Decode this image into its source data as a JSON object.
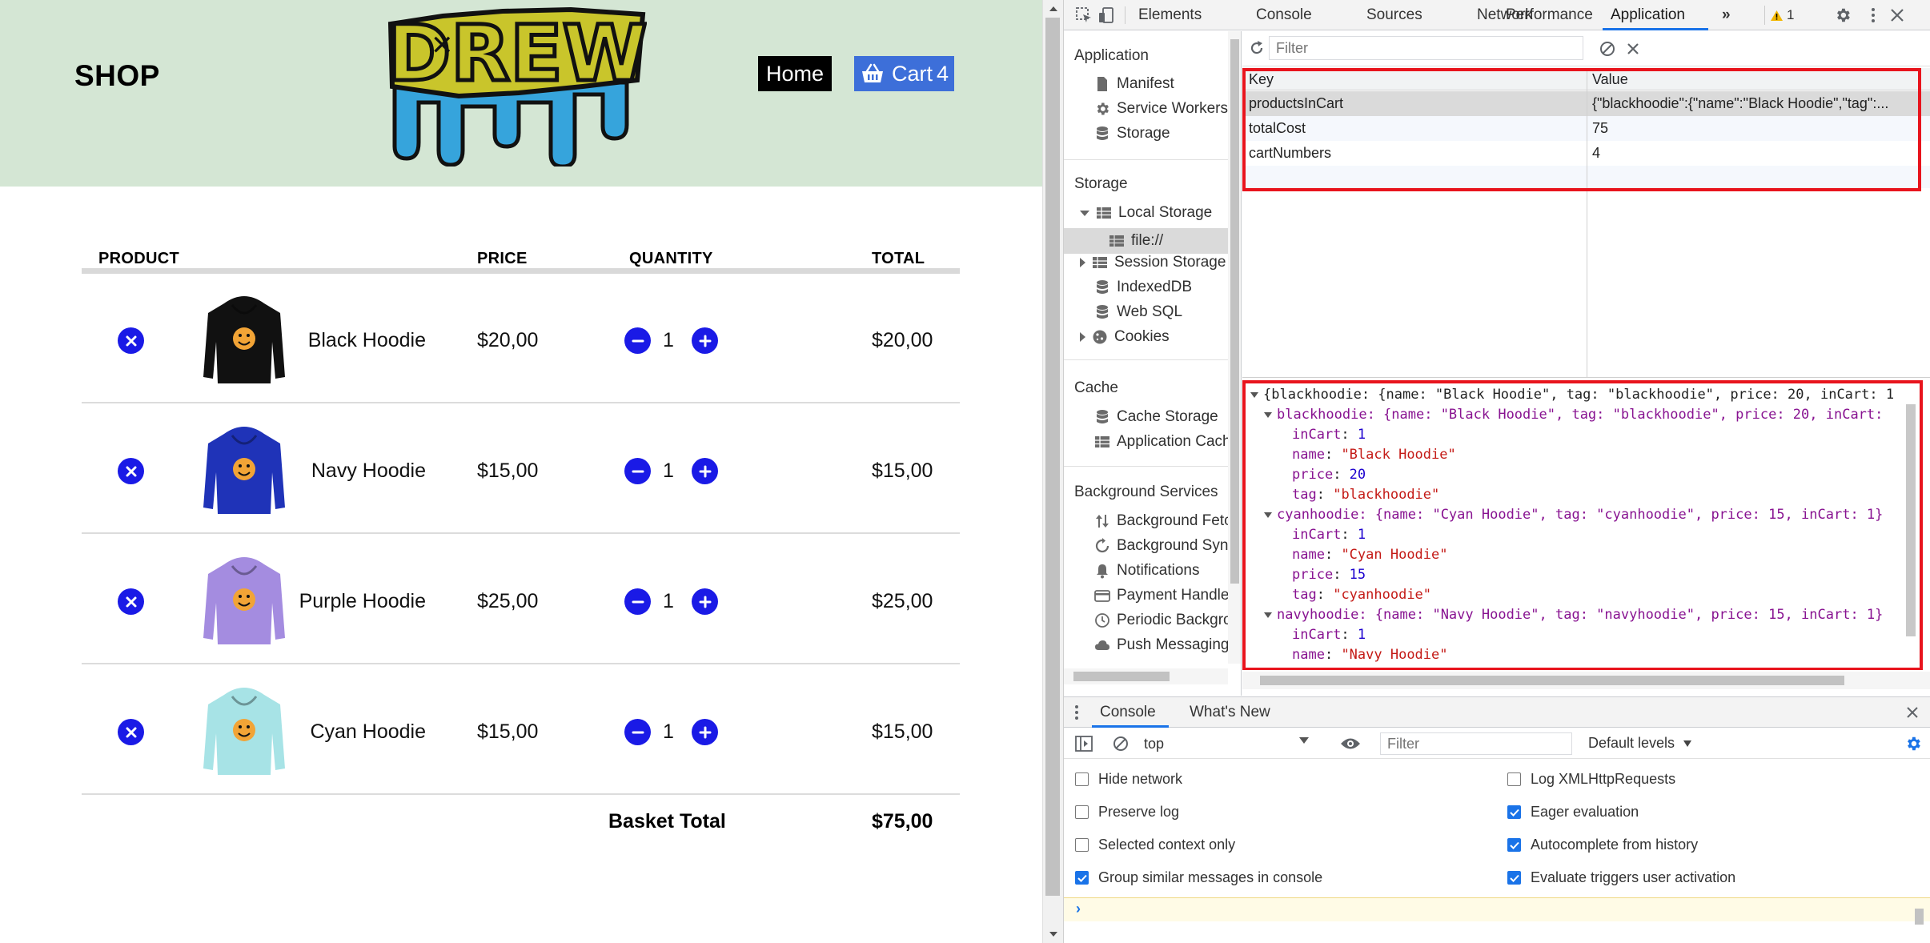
{
  "shop": {
    "title": "SHOP",
    "logo_text": "DREW",
    "nav": {
      "home_label": "Home",
      "cart_label": "Cart",
      "cart_count": "4"
    },
    "table": {
      "headers": {
        "product": "PRODUCT",
        "price": "PRICE",
        "quantity": "QUANTITY",
        "total": "TOTAL"
      },
      "rows": [
        {
          "name": "Black Hoodie",
          "price": "$20,00",
          "qty": "1",
          "total": "$20,00",
          "color": "#111111"
        },
        {
          "name": "Navy Hoodie",
          "price": "$15,00",
          "qty": "1",
          "total": "$15,00",
          "color": "#1f33b8"
        },
        {
          "name": "Purple Hoodie",
          "price": "$25,00",
          "qty": "1",
          "total": "$25,00",
          "color": "#a48ce0"
        },
        {
          "name": "Cyan Hoodie",
          "price": "$15,00",
          "qty": "1",
          "total": "$15,00",
          "color": "#a7e3e6"
        }
      ],
      "basket_total_label": "Basket Total",
      "basket_total_value": "$75,00"
    }
  },
  "devtools": {
    "tabs": [
      "Elements",
      "Console",
      "Sources",
      "Network",
      "Performance",
      "Application"
    ],
    "active_tab": "Application",
    "more_tabs": "»",
    "warning_count": "1",
    "sidebar": {
      "application_header": "Application",
      "application_items": [
        "Manifest",
        "Service Workers",
        "Storage"
      ],
      "storage_header": "Storage",
      "storage_items": [
        "Local Storage",
        "file://",
        "Session Storage",
        "IndexedDB",
        "Web SQL",
        "Cookies"
      ],
      "cache_header": "Cache",
      "cache_items": [
        "Cache Storage",
        "Application Cach"
      ],
      "bg_header": "Background Services",
      "bg_items": [
        "Background Fetc",
        "Background Sync",
        "Notifications",
        "Payment Handle",
        "Periodic Backgro",
        "Push Messaging"
      ]
    },
    "storage": {
      "filter_placeholder": "Filter",
      "columns": {
        "key": "Key",
        "value": "Value"
      },
      "rows": [
        {
          "key": "productsInCart",
          "value": "{\"blackhoodie\":{\"name\":\"Black Hoodie\",\"tag\":..."
        },
        {
          "key": "totalCost",
          "value": "75"
        },
        {
          "key": "cartNumbers",
          "value": "4"
        }
      ],
      "preview": {
        "root": "{blackhoodie: {name: \"Black Hoodie\", tag: \"blackhoodie\", price: 20, inCart: 1",
        "blackhoodie_summary": "blackhoodie: {name: \"Black Hoodie\", tag: \"blackhoodie\", price: 20, inCart:",
        "blackhoodie": {
          "inCart": "1",
          "name": "\"Black Hoodie\"",
          "price": "20",
          "tag": "\"blackhoodie\""
        },
        "cyanhoodie_summary": "cyanhoodie: {name: \"Cyan Hoodie\", tag: \"cyanhoodie\", price: 15, inCart: 1}",
        "cyanhoodie": {
          "inCart": "1",
          "name": "\"Cyan Hoodie\"",
          "price": "15",
          "tag": "\"cyanhoodie\""
        },
        "navyhoodie_summary": "navyhoodie: {name: \"Navy Hoodie\", tag: \"navyhoodie\", price: 15, inCart: 1}",
        "navyhoodie": {
          "inCart": "1",
          "name": "\"Navy Hoodie\""
        }
      }
    },
    "drawer": {
      "tabs": [
        "Console",
        "What's New"
      ],
      "context": "top",
      "filter_placeholder": "Filter",
      "levels": "Default levels",
      "options_left": [
        {
          "label": "Hide network",
          "checked": false
        },
        {
          "label": "Preserve log",
          "checked": false
        },
        {
          "label": "Selected context only",
          "checked": false
        },
        {
          "label": "Group similar messages in console",
          "checked": true
        }
      ],
      "options_right": [
        {
          "label": "Log XMLHttpRequests",
          "checked": false
        },
        {
          "label": "Eager evaluation",
          "checked": true
        },
        {
          "label": "Autocomplete from history",
          "checked": true
        },
        {
          "label": "Evaluate triggers user activation",
          "checked": true
        }
      ],
      "prompt": "›"
    }
  }
}
